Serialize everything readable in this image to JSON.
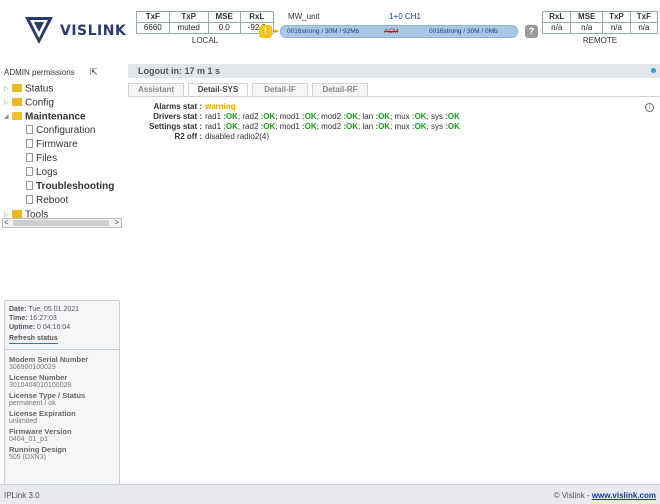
{
  "brand": {
    "name": "VISLINK",
    "logo_icon": "vislink-logo-icon"
  },
  "local": {
    "headers": [
      "TxF",
      "TxP",
      "MSE",
      "RxL"
    ],
    "values": [
      "6660",
      "muted",
      "0.0",
      "-92.0"
    ],
    "caption": "LOCAL"
  },
  "remote": {
    "headers": [
      "RxL",
      "MSE",
      "TxP",
      "TxF"
    ],
    "values": [
      "n/a",
      "n/a",
      "n/a",
      "n/a"
    ],
    "caption": "REMOTE"
  },
  "link": {
    "unit": "MW_unit",
    "channel": "1+0 CH1",
    "warn_badge": "!",
    "left_text": "0016strong / 30M / 92Mb",
    "acm": "ACM",
    "right_text": "0016strong / 30M / 0Mb",
    "help_badge": "?"
  },
  "sidebar": {
    "permissions": "ADMIN permissions",
    "tree": {
      "status": "Status",
      "config": "Config",
      "maintenance": "Maintenance",
      "configuration": "Configuration",
      "firmware": "Firmware",
      "files": "Files",
      "logs": "Logs",
      "troubleshooting": "Troubleshooting",
      "reboot": "Reboot",
      "tools": "Tools"
    },
    "scroll_left": "<",
    "scroll_right": ">"
  },
  "status_panel": {
    "date_label": "Date:",
    "date": "Tue, 05.01.2021",
    "time_label": "Time:",
    "time": "16:27:03",
    "uptime_label": "Uptime:",
    "uptime": "0 04:16:04",
    "refresh": "Refresh status"
  },
  "info_panel": {
    "serial_label": "Modem Serial Number",
    "serial": "306900100029",
    "license_label": "License Number",
    "license": "3010404010100029",
    "type_label": "License Type / Status",
    "type": "permanent / ok",
    "expiration_label": "License Expiration",
    "expiration": "unlimited",
    "fw_label": "Firmware Version",
    "fw": "0404_01_p1",
    "design_label": "Running Design",
    "design": "505 (DXN3)"
  },
  "main": {
    "logout_text": "Logout in: 17 m 1 s",
    "tabs": [
      "Assistant",
      "Detail-SYS",
      "Detail-IF",
      "Detail-RF"
    ],
    "active_tab": "Detail-SYS",
    "alarms_label": "Alarms stat :",
    "alarms_value": "warning",
    "drivers_label": "Drivers stat :",
    "settings_label": "Settings stat :",
    "r2_label": "R2 off :",
    "r2_value": "disabled radio2(4)",
    "ok": ":OK",
    "items": [
      "rad1",
      "rad2",
      "mod1",
      "mod2",
      "lan",
      "mux",
      "sys"
    ]
  },
  "footer": {
    "left": "IPLink 3.0",
    "copyright": "© Vislink -",
    "link": "www.vislink.com"
  },
  "colors": {
    "accent": "#2a3a6a",
    "warn": "#f5a000",
    "ok": "#1a9a1a",
    "link": "#1a3aa0"
  }
}
